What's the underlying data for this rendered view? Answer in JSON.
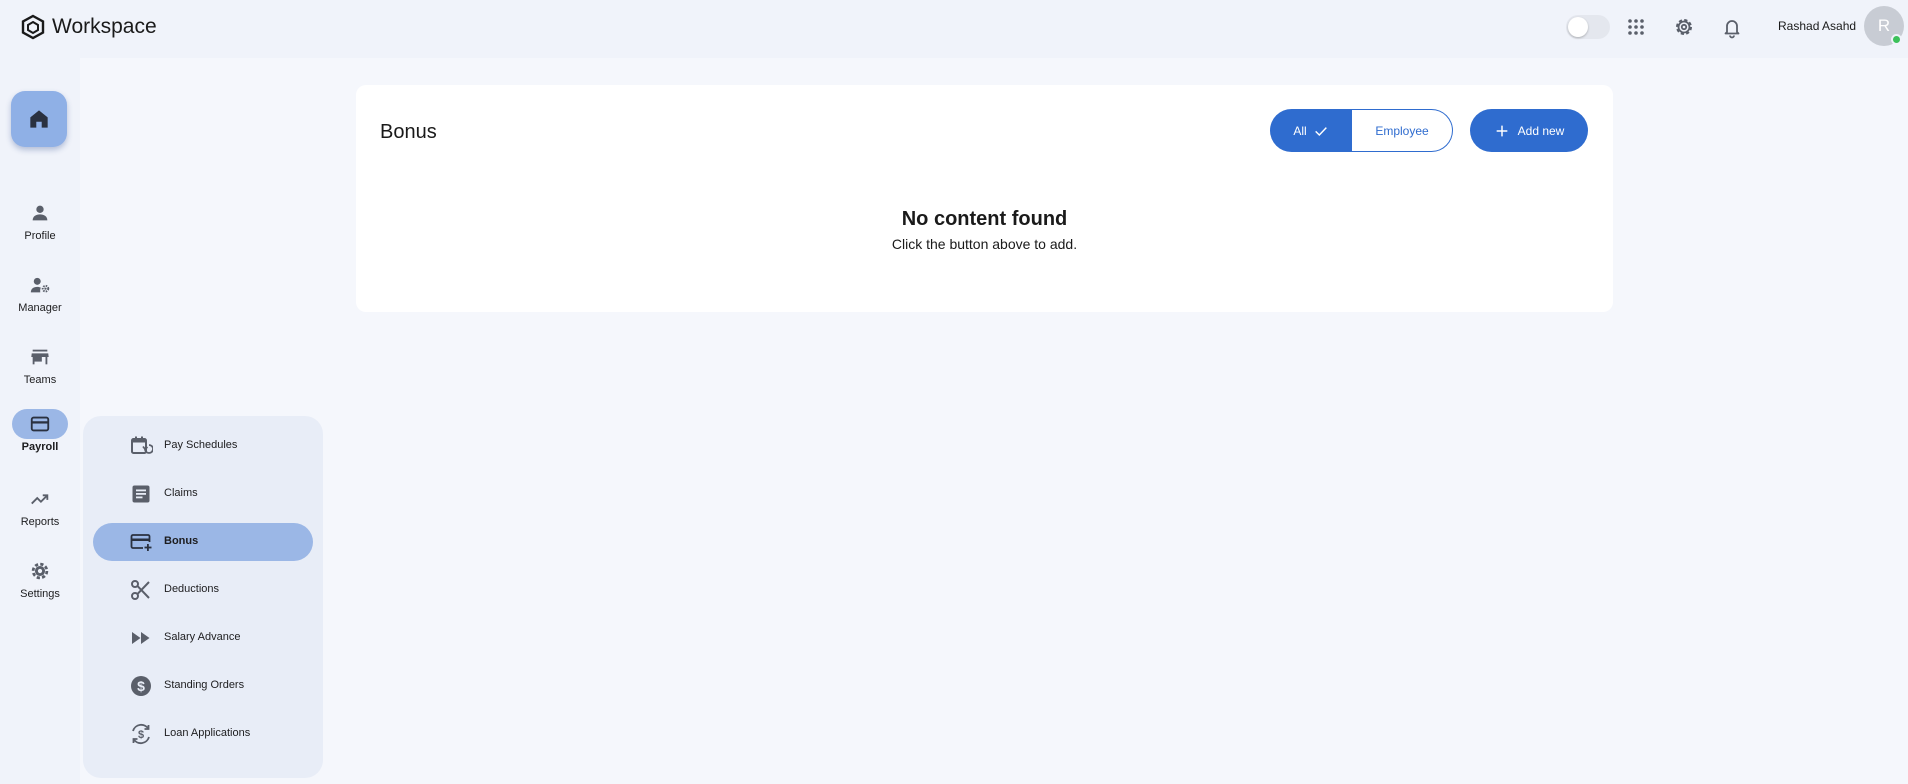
{
  "app": {
    "name": "Workspace"
  },
  "header": {
    "user_name": "Rashad Asahd",
    "avatar_initial": "R",
    "icons": [
      "theme-toggle",
      "apps-grid-icon",
      "settings-gear-icon",
      "bell-icon"
    ]
  },
  "rail": {
    "items": [
      {
        "label": "Profile",
        "icon": "person-icon"
      },
      {
        "label": "Manager",
        "icon": "manager-gear-icon"
      },
      {
        "label": "Teams",
        "icon": "store-icon"
      },
      {
        "label": "Payroll",
        "icon": "card-icon",
        "active": true
      },
      {
        "label": "Reports",
        "icon": "trending-up-icon"
      },
      {
        "label": "Settings",
        "icon": "gear-icon"
      }
    ]
  },
  "submenu": {
    "items": [
      {
        "label": "Pay Schedules",
        "icon": "calendar-refresh-icon"
      },
      {
        "label": "Claims",
        "icon": "document-icon"
      },
      {
        "label": "Bonus",
        "icon": "card-plus-icon",
        "active": true
      },
      {
        "label": "Deductions",
        "icon": "scissors-icon"
      },
      {
        "label": "Salary Advance",
        "icon": "fast-forward-icon"
      },
      {
        "label": "Standing Orders",
        "icon": "dollar-circle-icon"
      },
      {
        "label": "Loan Applications",
        "icon": "dollar-cycle-icon"
      }
    ]
  },
  "main": {
    "title": "Bonus",
    "filter": {
      "all_label": "All",
      "employee_label": "Employee",
      "selected": "All"
    },
    "add_label": "Add new",
    "empty_title": "No content found",
    "empty_subtitle": "Click the button above to add."
  },
  "colors": {
    "primary": "#2f6ccf",
    "active_pill": "#9bb7e6",
    "online": "#3cc15a"
  }
}
